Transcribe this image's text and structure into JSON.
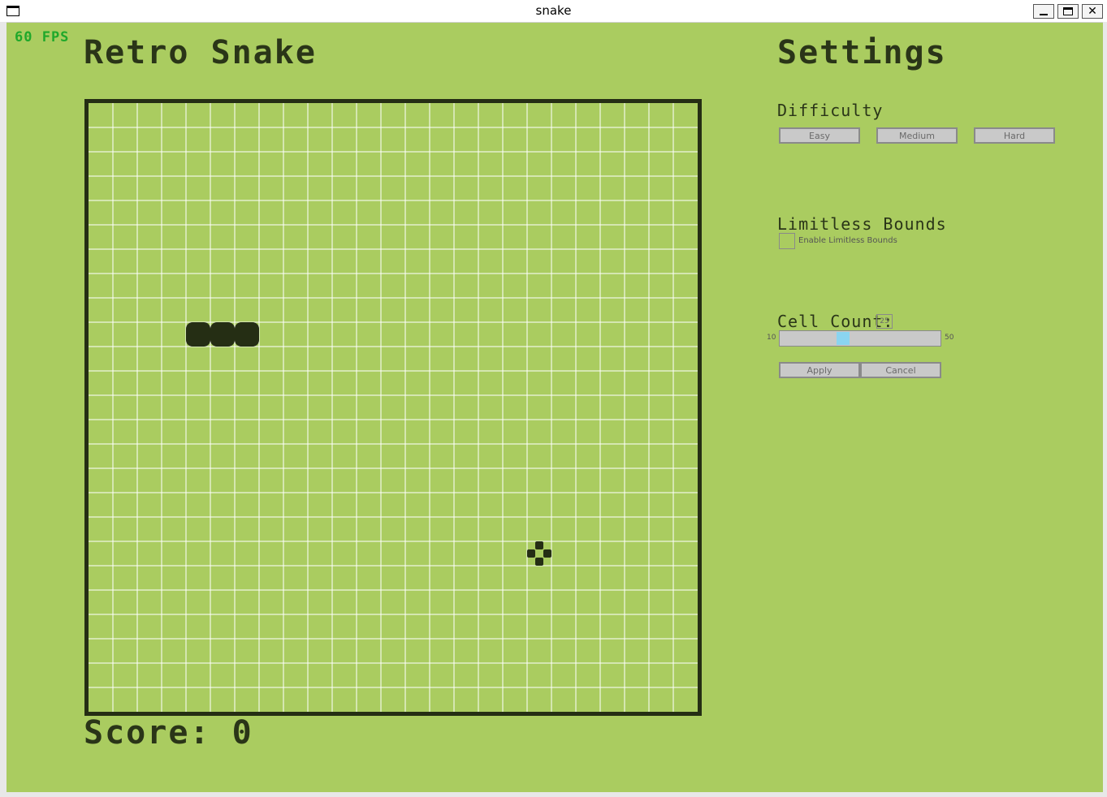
{
  "window": {
    "title": "snake",
    "minimize_icon": "minimize-icon",
    "maximize_icon": "maximize-icon",
    "close_icon": "close-icon"
  },
  "hud": {
    "fps": "60 FPS"
  },
  "game": {
    "title": "Retro Snake",
    "score_text": "Score: 0",
    "grid_cells": 25,
    "snake_cells": [
      [
        4,
        9
      ],
      [
        5,
        9
      ],
      [
        6,
        9
      ]
    ],
    "food_cell": [
      18,
      18
    ]
  },
  "settings": {
    "title": "Settings",
    "difficulty": {
      "label": "Difficulty",
      "options": [
        "Easy",
        "Medium",
        "Hard"
      ]
    },
    "limitless_bounds": {
      "label": "Limitless Bounds",
      "checkbox_label": "Enable Limitless Bounds",
      "checked": false
    },
    "cell_count": {
      "label": "Cell Count:",
      "value": "25",
      "min_label": "10",
      "max_label": "50",
      "min": 10,
      "max": 50,
      "current": 25
    },
    "apply_label": "Apply",
    "cancel_label": "Cancel"
  },
  "colors": {
    "background": "#aacc60",
    "snake": "#252e14",
    "grid_line": "#ffffff",
    "fps": "#1fa82a",
    "slider_thumb": "#8ad4f0"
  }
}
